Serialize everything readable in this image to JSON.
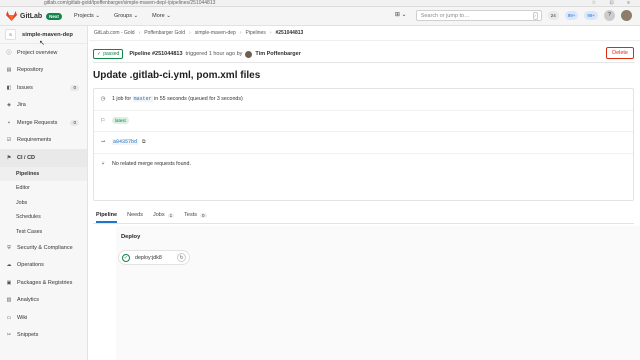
{
  "browser": {
    "url": "gitlab.com/gitlab-gold/tpoffenbarger/simple-maven-dep/-/pipelines/251044813"
  },
  "nav": {
    "brand": "GitLab",
    "badge": "Next",
    "menus": [
      "Projects ⌄",
      "Groups ⌄",
      "More ⌄"
    ],
    "search_placeholder": "Search or jump to…",
    "counters": [
      "24",
      "99+",
      "99+"
    ],
    "plus": "⊞ ⌄"
  },
  "sidebar": {
    "project_avatar": "S",
    "project_name": "simple-maven-dep",
    "items": [
      {
        "label": "Project overview",
        "icon": "info-icon"
      },
      {
        "label": "Repository",
        "icon": "repo-icon"
      },
      {
        "label": "Issues",
        "icon": "issues-icon",
        "badge": "0"
      },
      {
        "label": "Jira",
        "icon": "jira-icon"
      },
      {
        "label": "Merge Requests",
        "icon": "merge-icon",
        "badge": "0"
      },
      {
        "label": "Requirements",
        "icon": "requirements-icon"
      },
      {
        "label": "CI / CD",
        "icon": "rocket-icon"
      }
    ],
    "subitems": [
      "Pipelines",
      "Editor",
      "Jobs",
      "Schedules",
      "Test Cases"
    ],
    "items2": [
      {
        "label": "Security & Compliance",
        "icon": "shield-icon"
      },
      {
        "label": "Operations",
        "icon": "cloud-icon"
      },
      {
        "label": "Packages & Registries",
        "icon": "package-icon"
      },
      {
        "label": "Analytics",
        "icon": "chart-icon"
      },
      {
        "label": "Wiki",
        "icon": "book-icon"
      },
      {
        "label": "Snippets",
        "icon": "snippet-icon"
      }
    ]
  },
  "breadcrumb": [
    "GitLab.com - Gold",
    "Poffenbarger Gold",
    "simple-maven-dep",
    "Pipelines",
    "#251044813"
  ],
  "pipeline": {
    "status": "passed",
    "number": "Pipeline #251044813",
    "triggered": "triggered 1 hour ago by",
    "user": "Tim Poffenbarger",
    "delete_label": "Delete",
    "title": "Update .gitlab-ci.yml, pom.xml files",
    "jobs_text_pre": "1 job for",
    "branch": "master",
    "jobs_text_post": "in 55 seconds (queued for 3 seconds)",
    "tag": "latest",
    "commit": "a84357bd",
    "mr_text": "No related merge requests found."
  },
  "tabs": [
    {
      "label": "Pipeline",
      "count": ""
    },
    {
      "label": "Needs",
      "count": ""
    },
    {
      "label": "Jobs",
      "count": "1"
    },
    {
      "label": "Tests",
      "count": "0"
    }
  ],
  "graph": {
    "stage": "Deploy",
    "job": "deploy:jdk8"
  }
}
